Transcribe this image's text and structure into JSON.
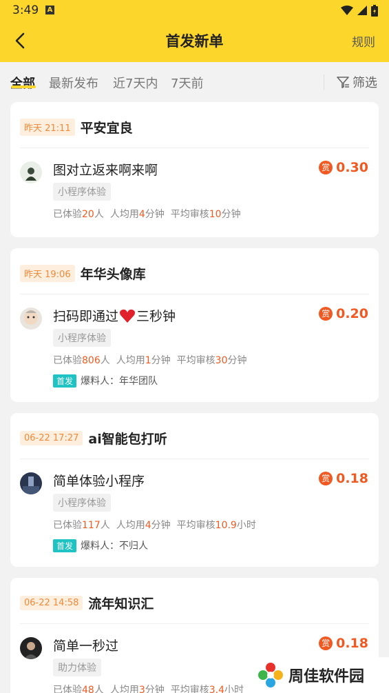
{
  "status_bar": {
    "time": "3:49",
    "badge": "A"
  },
  "nav": {
    "title": "首发新单",
    "rule_label": "规则"
  },
  "tabs": [
    {
      "label": "全部",
      "active": true
    },
    {
      "label": "最新发布",
      "active": false
    },
    {
      "label": "近7天内",
      "active": false
    },
    {
      "label": "7天前",
      "active": false
    }
  ],
  "filter_label": "筛选",
  "stat_labels": {
    "experienced": "已体验",
    "person": "人",
    "avg_use": "人均用",
    "avg_review": "平均审核",
    "minutes": "分钟",
    "hours": "小时"
  },
  "source_prefix": "爆料人：",
  "first_badge": "首发",
  "reward_icon_label": "赏",
  "cards": [
    {
      "time": "昨天 21:11",
      "name": "平安宜良",
      "task_title": "图对立返来啊来啊",
      "reward": "0.30",
      "type": "小程序体验",
      "experienced": "20",
      "avg_use": "4",
      "avg_review": "10",
      "review_unit": "分钟"
    },
    {
      "time": "昨天 19:06",
      "name": "年华头像库",
      "task_title": "扫码即通过",
      "task_title_suffix": "三秒钟",
      "reward": "0.20",
      "type": "小程序体验",
      "experienced": "806",
      "avg_use": "1",
      "avg_review": "30",
      "review_unit": "分钟",
      "source": "年华团队"
    },
    {
      "time": "06-22 17:27",
      "name": "ai智能包打听",
      "task_title": "简单体验小程序",
      "reward": "0.18",
      "type": "小程序体验",
      "experienced": "117",
      "avg_use": "4",
      "avg_review": "10.9",
      "review_unit": "小时",
      "source": "不归人"
    },
    {
      "time": "06-22 14:58",
      "name": "流年知识汇",
      "task_title": "简单一秒过",
      "reward": "0.18",
      "type": "助力体验",
      "experienced": "48",
      "avg_use": "3",
      "avg_review": "3.4",
      "review_unit": "小时"
    }
  ],
  "watermark": "周佳软件园",
  "colors": {
    "brand_yellow": "#fcd62a",
    "reward_red": "#f05a22",
    "badge_orange": "#f08a3c",
    "first_teal": "#1fc3c3"
  }
}
